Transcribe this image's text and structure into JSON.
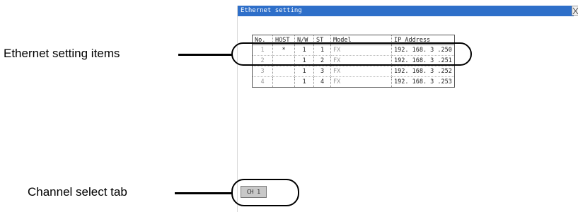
{
  "window": {
    "title": "Ethernet setting"
  },
  "table": {
    "headers": [
      "No.",
      "HOST",
      "N/W",
      "ST",
      "Model",
      "IP Address"
    ],
    "rows": [
      {
        "no": "1",
        "host": "*",
        "nw": "1",
        "st": "1",
        "model": "FX",
        "ip": "192. 168.  3 .250"
      },
      {
        "no": "2",
        "host": "",
        "nw": "1",
        "st": "2",
        "model": "FX",
        "ip": "192. 168.  3 .251"
      },
      {
        "no": "3",
        "host": "",
        "nw": "1",
        "st": "3",
        "model": "FX",
        "ip": "192. 168.  3 .252"
      },
      {
        "no": "4",
        "host": "",
        "nw": "1",
        "st": "4",
        "model": "FX",
        "ip": "192. 168.  3 .253"
      }
    ]
  },
  "channel_tab": {
    "label": "CH 1"
  },
  "callouts": {
    "items": "Ethernet setting items",
    "tab": "Channel select tab"
  },
  "icons": {
    "close": "close-icon"
  }
}
